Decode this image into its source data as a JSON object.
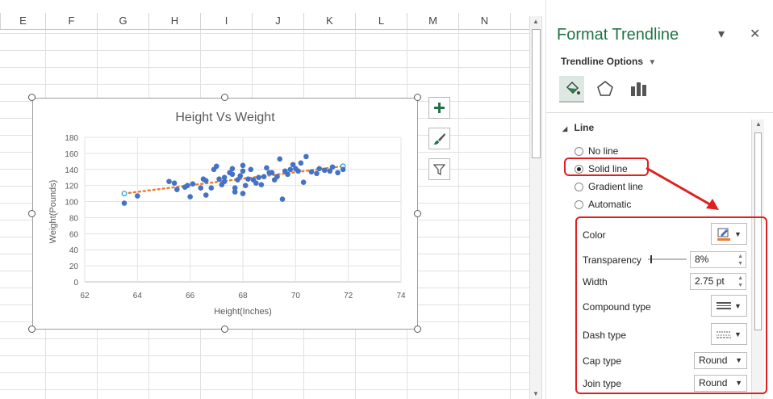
{
  "sheet": {
    "columns": [
      "E",
      "F",
      "G",
      "H",
      "I",
      "J",
      "K",
      "L",
      "M",
      "N"
    ]
  },
  "chart_data": {
    "type": "scatter",
    "title": "Height Vs Weight",
    "xlabel": "Height(Inches)",
    "ylabel": "Weight(Pounds)",
    "xlim": [
      62,
      74
    ],
    "ylim": [
      0,
      180
    ],
    "xticks": [
      "62",
      "64",
      "66",
      "68",
      "70",
      "72",
      "74"
    ],
    "yticks": [
      "0",
      "20",
      "40",
      "60",
      "80",
      "100",
      "120",
      "140",
      "160",
      "180"
    ],
    "grid": true,
    "point_color": "#4472c4",
    "trendline_color": "#ed7d31",
    "points": [
      [
        63.5,
        98
      ],
      [
        64.0,
        107
      ],
      [
        65.2,
        125
      ],
      [
        65.4,
        123
      ],
      [
        65.5,
        115
      ],
      [
        65.8,
        118
      ],
      [
        65.9,
        120
      ],
      [
        66.0,
        106
      ],
      [
        66.1,
        122
      ],
      [
        66.4,
        117
      ],
      [
        66.5,
        128
      ],
      [
        66.6,
        126
      ],
      [
        66.6,
        108
      ],
      [
        66.8,
        117
      ],
      [
        66.9,
        140
      ],
      [
        67.0,
        144
      ],
      [
        67.1,
        128
      ],
      [
        67.2,
        121
      ],
      [
        67.3,
        130
      ],
      [
        67.3,
        125
      ],
      [
        67.5,
        136
      ],
      [
        67.6,
        134
      ],
      [
        67.6,
        141
      ],
      [
        67.7,
        117
      ],
      [
        67.7,
        112
      ],
      [
        67.8,
        127
      ],
      [
        67.9,
        132
      ],
      [
        68.0,
        145
      ],
      [
        68.0,
        138
      ],
      [
        68.0,
        110
      ],
      [
        68.1,
        120
      ],
      [
        68.2,
        128
      ],
      [
        68.3,
        140
      ],
      [
        68.4,
        127
      ],
      [
        68.5,
        123
      ],
      [
        68.6,
        130
      ],
      [
        68.7,
        121
      ],
      [
        68.8,
        131
      ],
      [
        68.9,
        142
      ],
      [
        69.0,
        136
      ],
      [
        69.1,
        136
      ],
      [
        69.2,
        127
      ],
      [
        69.3,
        131
      ],
      [
        69.4,
        153
      ],
      [
        69.5,
        103
      ],
      [
        69.6,
        138
      ],
      [
        69.7,
        134
      ],
      [
        69.8,
        140
      ],
      [
        69.9,
        146
      ],
      [
        70.0,
        141
      ],
      [
        70.1,
        138
      ],
      [
        70.2,
        148
      ],
      [
        70.3,
        124
      ],
      [
        70.4,
        156
      ],
      [
        70.6,
        137
      ],
      [
        70.8,
        135
      ],
      [
        70.9,
        141
      ],
      [
        71.1,
        139
      ],
      [
        71.3,
        138
      ],
      [
        71.4,
        143
      ],
      [
        71.6,
        136
      ],
      [
        71.8,
        140
      ]
    ],
    "trend_start": [
      63.5,
      110
    ],
    "trend_end": [
      71.8,
      144
    ]
  },
  "chart_buttons": {
    "elements": "+",
    "styles": "brush",
    "filters": "filter"
  },
  "panel": {
    "title": "Format Trendline",
    "dropdown_arrow": "▾",
    "close": "✕",
    "options_label": "Trendline Options",
    "options_caret": "▼",
    "section_label": "Line",
    "section_caret": "◢",
    "radios": {
      "no_line": "No line",
      "solid_line": "Solid line",
      "gradient_line": "Gradient line",
      "automatic": "Automatic"
    },
    "rows": {
      "color": "Color",
      "transparency": "Transparency",
      "width": "Width",
      "compound_type": "Compound type",
      "dash_type": "Dash type",
      "cap_type": "Cap type",
      "join_type": "Join type"
    },
    "values": {
      "transparency": "8%",
      "width": "2.75 pt",
      "cap_type": "Round",
      "join_type": "Round"
    },
    "accent_color": "#217346",
    "line_color": "#ed7d31"
  }
}
